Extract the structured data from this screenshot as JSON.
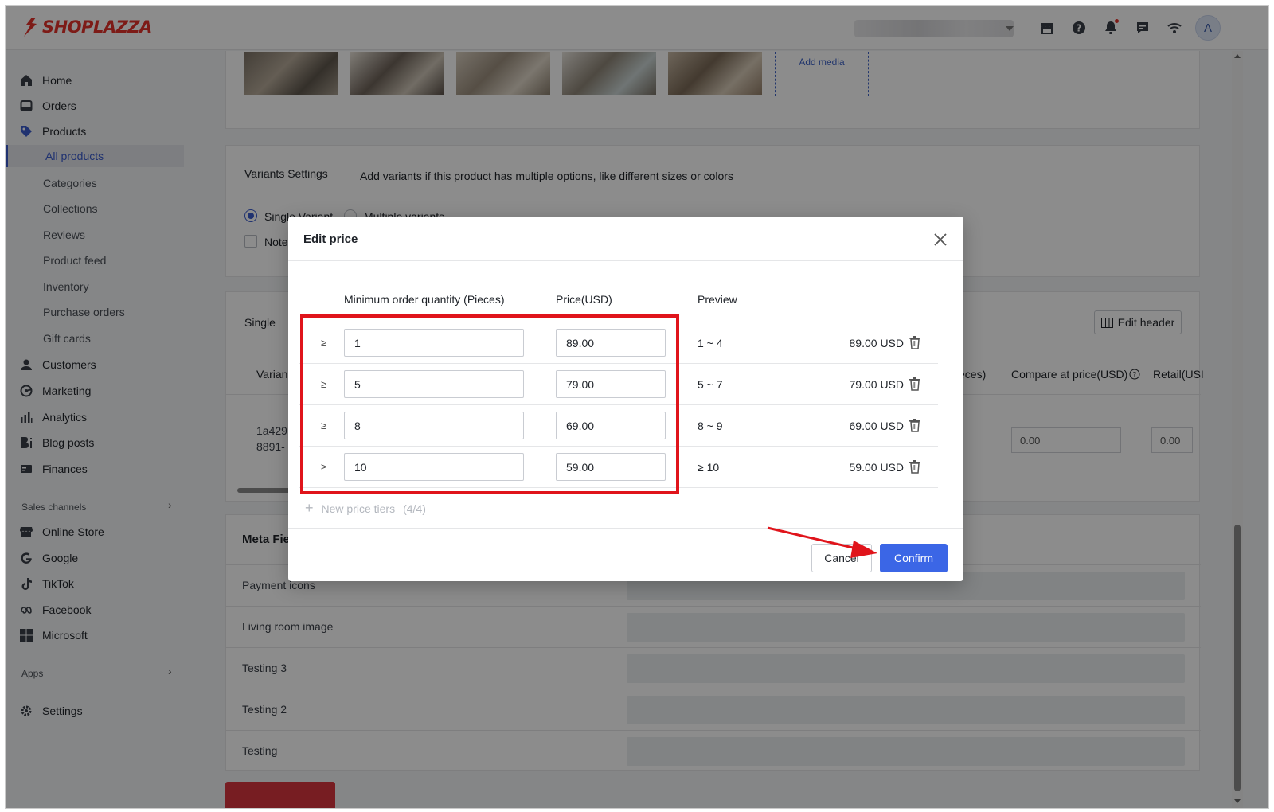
{
  "brand": {
    "name": "SHOPLAZZA",
    "color": "#e4322b"
  },
  "topbar": {
    "icons": [
      "store-icon",
      "help-icon",
      "bell-icon",
      "chat-icon",
      "wifi-icon"
    ],
    "avatar_initial": "A"
  },
  "sidebar": {
    "items": [
      {
        "label": "Home",
        "icon": "home-icon"
      },
      {
        "label": "Orders",
        "icon": "orders-icon"
      },
      {
        "label": "Products",
        "icon": "tag-icon"
      }
    ],
    "product_subitems": [
      "All products",
      "Categories",
      "Collections",
      "Reviews",
      "Product feed",
      "Inventory",
      "Purchase orders",
      "Gift cards"
    ],
    "items_after": [
      {
        "label": "Customers",
        "icon": "user-icon"
      },
      {
        "label": "Marketing",
        "icon": "marketing-icon"
      },
      {
        "label": "Analytics",
        "icon": "analytics-icon"
      },
      {
        "label": "Blog posts",
        "icon": "blog-icon"
      },
      {
        "label": "Finances",
        "icon": "finance-icon"
      }
    ],
    "sales_channels_label": "Sales channels",
    "channels": [
      {
        "label": "Online Store",
        "icon": "store-icon"
      },
      {
        "label": "Google",
        "icon": "google-icon"
      },
      {
        "label": "TikTok",
        "icon": "tiktok-icon"
      },
      {
        "label": "Facebook",
        "icon": "meta-icon"
      },
      {
        "label": "Microsoft",
        "icon": "microsoft-icon"
      }
    ],
    "apps_label": "Apps",
    "settings_label": "Settings"
  },
  "main": {
    "add_media": "Add media",
    "variants": {
      "title": "Variants Settings",
      "description": "Add variants if this product has multiple options, like different sizes or colors",
      "single_label": "Single Variant",
      "multiple_label": "Multiple variants",
      "note_label": "Note"
    },
    "single": {
      "title_partial": "Single ",
      "edit_header": "Edit header",
      "col_variant": "Varian",
      "col_qty_partial": "eces)",
      "col_compare": "Compare at price(USD)",
      "col_retail": "Retail(USI",
      "variant_id_line1": "1a429",
      "variant_id_line2": "8891-",
      "compare_value": "0.00",
      "retail_value": "0.00"
    },
    "meta": {
      "title_partial": "Meta Fie",
      "rows": [
        "Payment icons",
        "Living room image",
        "Testing 3",
        "Testing 2",
        "Testing"
      ]
    }
  },
  "modal": {
    "title": "Edit price",
    "col_qty": "Minimum order quantity (Pieces)",
    "col_price": "Price(USD)",
    "col_preview": "Preview",
    "ge_symbol": "≥",
    "tiers": [
      {
        "qty": "1",
        "price": "89.00",
        "range": "1 ~ 4",
        "preview": "89.00 USD"
      },
      {
        "qty": "5",
        "price": "79.00",
        "range": "5 ~ 7",
        "preview": "79.00 USD"
      },
      {
        "qty": "8",
        "price": "69.00",
        "range": "8 ~ 9",
        "preview": "69.00 USD"
      },
      {
        "qty": "10",
        "price": "59.00",
        "range": "≥ 10",
        "preview": "59.00 USD"
      }
    ],
    "new_tier_label": "New price tiers",
    "new_tier_count": "(4/4)",
    "cancel_label": "Cancel",
    "confirm_label": "Confirm",
    "confirm_color": "#3b66e6",
    "highlight_color": "#e0141b"
  }
}
